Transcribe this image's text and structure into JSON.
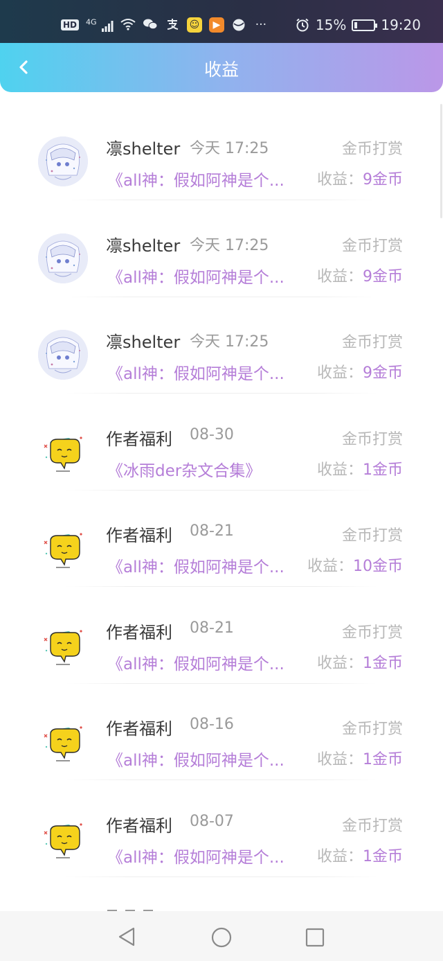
{
  "status_bar": {
    "hd_label": "HD",
    "network_label": "4G",
    "more": "···",
    "battery_percent": "15%",
    "battery_level": 0.15,
    "time": "19:20",
    "icons": [
      "hd-icon",
      "signal-icon",
      "wifi-icon",
      "wechat-icon",
      "alipay-icon",
      "app-yellow-icon",
      "app-orange-icon",
      "app-globe-icon",
      "alarm-icon",
      "battery-icon"
    ]
  },
  "header": {
    "title": "收益",
    "back_icon": "chevron-left-icon"
  },
  "list": {
    "label_earn": "收益：",
    "items": [
      {
        "avatar": "anime",
        "name": "凛shelter",
        "time": "今天 17:25",
        "type": "金币打赏",
        "book": "《all神：假如阿神是个...",
        "value": "9金币"
      },
      {
        "avatar": "anime",
        "name": "凛shelter",
        "time": "今天 17:25",
        "type": "金币打赏",
        "book": "《all神：假如阿神是个...",
        "value": "9金币"
      },
      {
        "avatar": "anime",
        "name": "凛shelter",
        "time": "今天 17:25",
        "type": "金币打赏",
        "book": "《all神：假如阿神是个...",
        "value": "9金币"
      },
      {
        "avatar": "mascot",
        "name": "作者福利",
        "time": "08-30",
        "type": "金币打赏",
        "book": "《冰雨der杂文合集》",
        "value": "1金币"
      },
      {
        "avatar": "mascot",
        "name": "作者福利",
        "time": "08-21",
        "type": "金币打赏",
        "book": "《all神：假如阿神是个...",
        "value": "10金币"
      },
      {
        "avatar": "mascot",
        "name": "作者福利",
        "time": "08-21",
        "type": "金币打赏",
        "book": "《all神：假如阿神是个...",
        "value": "1金币"
      },
      {
        "avatar": "mascot",
        "name": "作者福利",
        "time": "08-16",
        "type": "金币打赏",
        "book": "《all神：假如阿神是个...",
        "value": "1金币"
      },
      {
        "avatar": "mascot",
        "name": "作者福利",
        "time": "08-07",
        "type": "金币打赏",
        "book": "《all神：假如阿神是个...",
        "value": "1金币"
      }
    ]
  },
  "nav_bar": {
    "icons": [
      "back-triangle-icon",
      "home-circle-icon",
      "recents-square-icon"
    ]
  },
  "colors": {
    "header_start": "#4fd2ef",
    "header_end": "#bb97e8",
    "accent_purple": "#b57ed8",
    "muted_gray": "#b8b8b8"
  }
}
